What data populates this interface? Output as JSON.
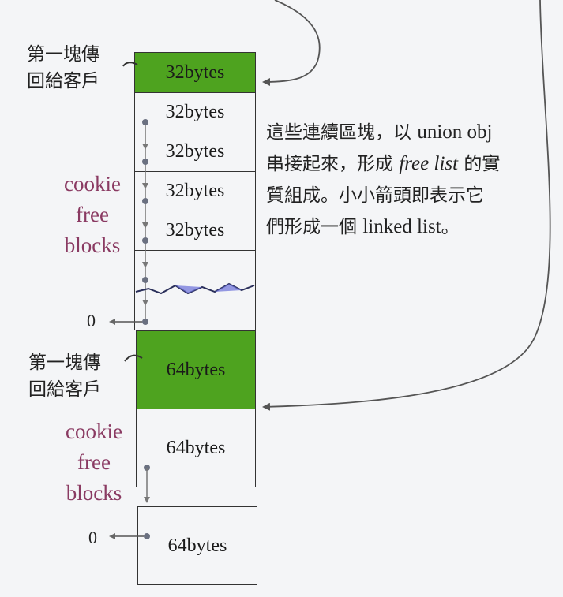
{
  "top_group": {
    "first_label_line1": "第一塊傳",
    "first_label_line2": "回給客戶",
    "cookie": [
      "cookie",
      "free",
      "blocks"
    ],
    "blocks": [
      "32bytes",
      "32bytes",
      "32bytes",
      "32bytes",
      "32bytes"
    ],
    "null_marker": "0"
  },
  "bottom_group": {
    "first_label_line1": "第一塊傳",
    "first_label_line2": "回給客戶",
    "cookie": [
      "cookie",
      "free",
      "blocks"
    ],
    "blocks": [
      "64bytes",
      "64bytes",
      "64bytes"
    ],
    "null_marker": "0"
  },
  "note": {
    "line1_cn": "這些連續區塊，以 ",
    "line1_latin": "union obj",
    "line2_cn": "串接起來，形成 ",
    "line2_italic": "free list",
    "line2_cn_end": " 的實",
    "line3": "質組成。小小箭頭即表示它",
    "line4_cn": "們形成一個 ",
    "line4_latin": "linked list",
    "line4_end": "。"
  },
  "colors": {
    "green_fill": "#4ea31f",
    "cookie_text": "#8a3a62",
    "arrow": "#555555",
    "wave_fill": "#6a6fd8"
  }
}
